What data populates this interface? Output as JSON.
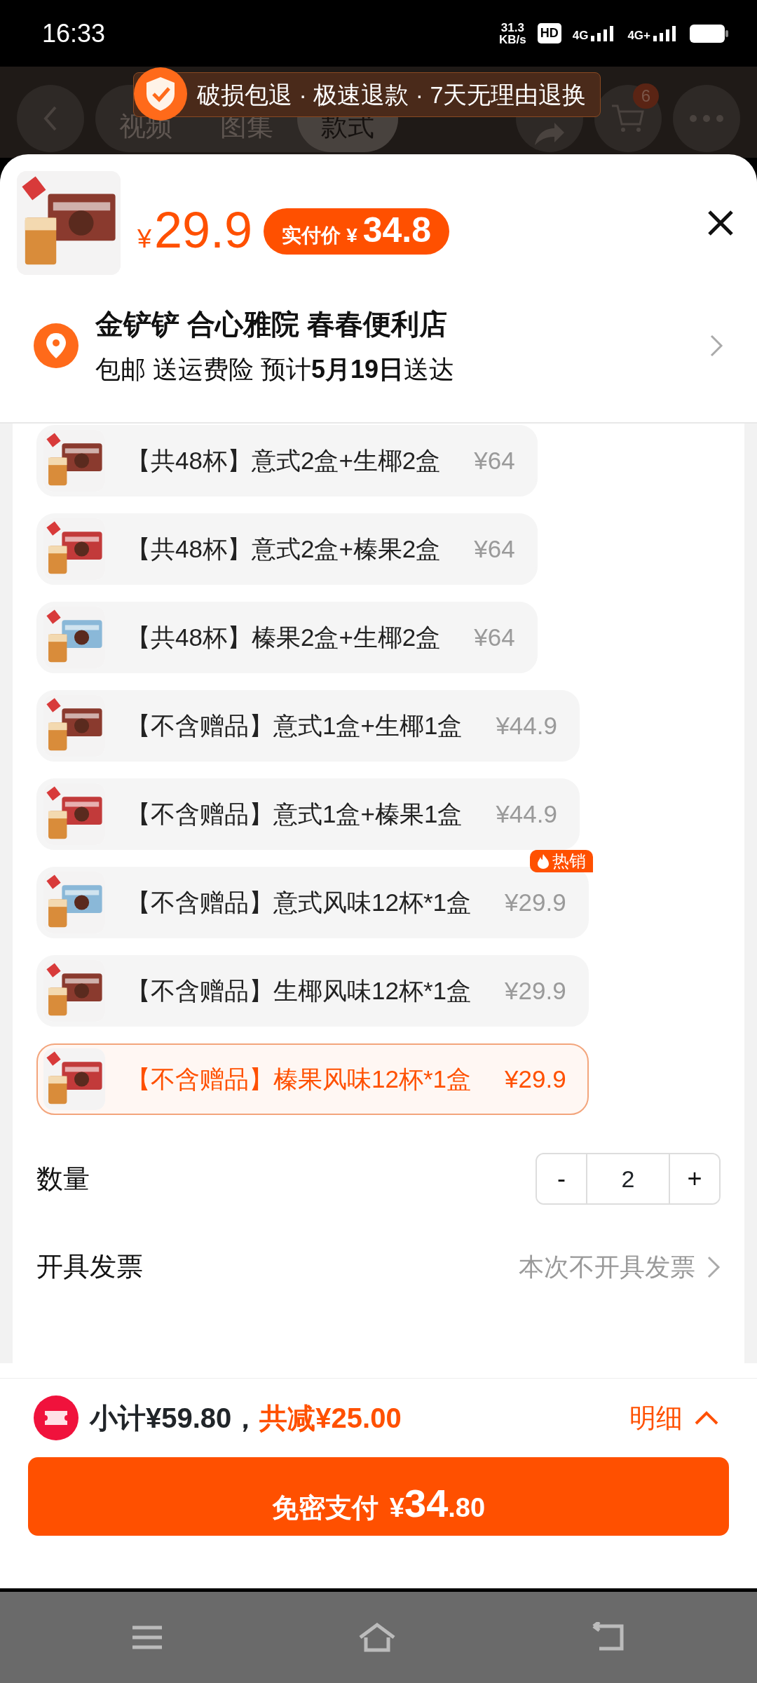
{
  "status_bar": {
    "time": "16:33",
    "net_speed": "31.3",
    "net_unit": "KB/s",
    "hd": "HD",
    "sims": [
      "4G",
      "4G+"
    ]
  },
  "header": {
    "tabs": [
      {
        "label": "视频",
        "selected": false
      },
      {
        "label": "图集",
        "selected": false
      },
      {
        "label": "款式",
        "selected": true
      }
    ],
    "cart_count": "6"
  },
  "banner": {
    "text": "破损包退 · 极速退款 · 7天无理由退换"
  },
  "product": {
    "currency": "¥",
    "price": "29.9",
    "paid_label": "实付价",
    "paid_currency": "¥",
    "paid_price": "34.8"
  },
  "address": {
    "name": "金铲铲 合心雅院 春春便利店",
    "delivery": "包邮 送运费险 预计**5月19日**送达"
  },
  "options": [
    {
      "label": "【共48杯】意式2盒+生椰2盒",
      "price": "¥64",
      "selected": false
    },
    {
      "label": "【共48杯】意式2盒+榛果2盒",
      "price": "¥64",
      "selected": false
    },
    {
      "label": "【共48杯】榛果2盒+生椰2盒",
      "price": "¥64",
      "selected": false
    },
    {
      "label": "【不含赠品】意式1盒+生椰1盒",
      "price": "¥44.9",
      "selected": false
    },
    {
      "label": "【不含赠品】意式1盒+榛果1盒",
      "price": "¥44.9",
      "selected": false
    },
    {
      "label": "【不含赠品】意式风味12杯*1盒",
      "price": "¥29.9",
      "selected": false,
      "badge": "热销"
    },
    {
      "label": "【不含赠品】生椰风味12杯*1盒",
      "price": "¥29.9",
      "selected": false
    },
    {
      "label": "【不含赠品】榛果风味12杯*1盒",
      "price": "¥29.9",
      "selected": true
    }
  ],
  "quantity": {
    "label": "数量",
    "minus": "-",
    "value": "2",
    "plus": "+"
  },
  "invoice": {
    "label": "开具发票",
    "value": "本次不开具发票"
  },
  "summary": {
    "subtotal": "小计¥59.80，",
    "discount": "共减¥25.00",
    "detail": "明细"
  },
  "pay_button": {
    "label": "免密支付",
    "currency": "¥",
    "integer": "34",
    "decimal": ".80"
  }
}
